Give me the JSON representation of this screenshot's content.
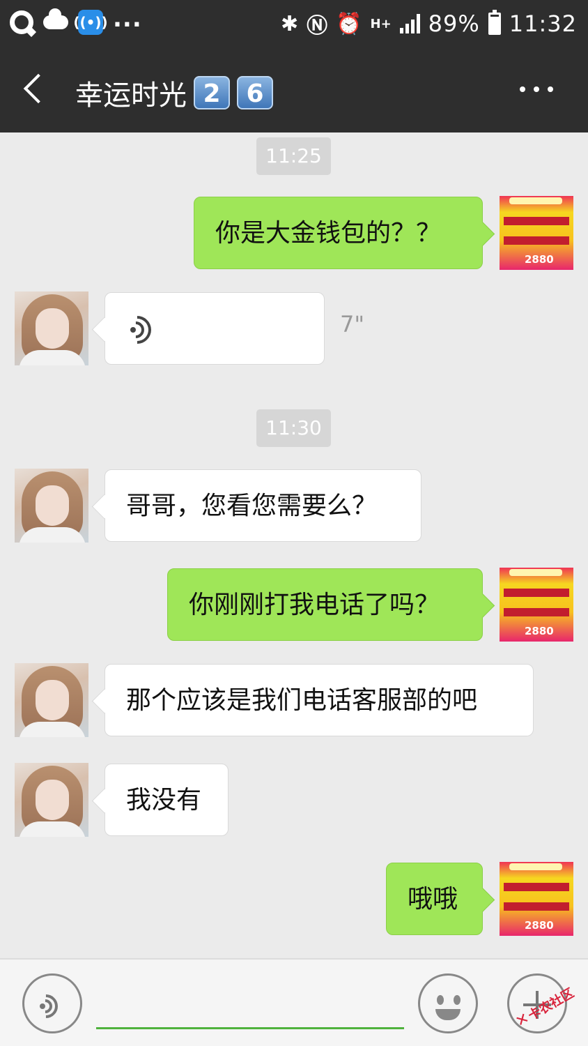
{
  "status_bar": {
    "battery": "89%",
    "time": "11:32",
    "battery_level": 0.89,
    "icons": [
      "qq-icon",
      "cloud-icon",
      "wifi-app-icon",
      "bluetooth-icon",
      "nfc-icon",
      "alarm-icon",
      "hplus-icon",
      "signal-icon",
      "battery-icon"
    ],
    "more": "..."
  },
  "header": {
    "title": "幸运时光",
    "badge_1": "2",
    "badge_2": "6"
  },
  "messages": [
    {
      "type": "time",
      "text": "11:25"
    },
    {
      "type": "text",
      "side": "right",
      "text": "你是大金钱包的？？"
    },
    {
      "type": "voice",
      "side": "left",
      "duration": "7\""
    },
    {
      "type": "time",
      "text": "11:30"
    },
    {
      "type": "text",
      "side": "left",
      "text": "哥哥，您看您需要么？"
    },
    {
      "type": "text",
      "side": "right",
      "text": "你刚刚打我电话了吗？"
    },
    {
      "type": "text",
      "side": "left",
      "text": "那个应该是我们电话客服部的吧"
    },
    {
      "type": "text",
      "side": "left",
      "text": "我没有"
    },
    {
      "type": "text",
      "side": "right",
      "text": "哦哦"
    }
  ],
  "self_avatar_text": "2880",
  "input": {
    "value": "",
    "placeholder": ""
  },
  "watermark": "卡农社区",
  "colors": {
    "header_bg": "#2e2e2e",
    "chat_bg": "#ebebeb",
    "right_bubble": "#9fe658",
    "left_bubble": "#ffffff",
    "input_underline": "#4fb23c"
  }
}
